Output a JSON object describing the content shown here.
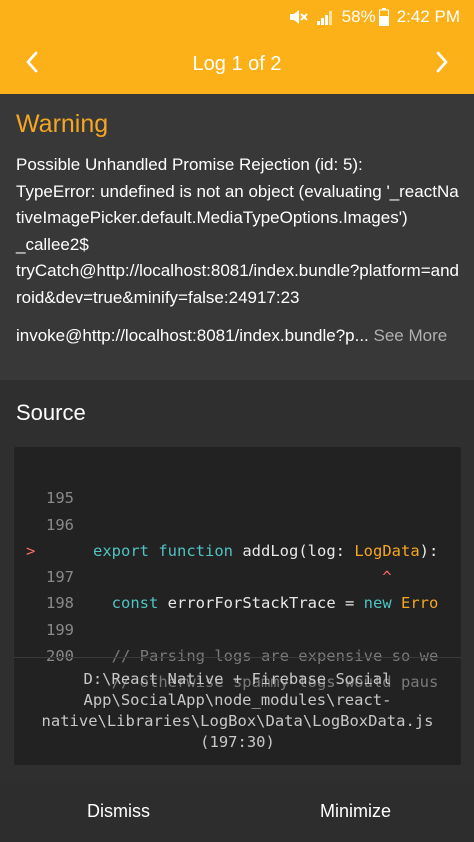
{
  "status_bar": {
    "mute_icon": "mute-icon",
    "signal_icon": "signal-icon",
    "battery_percent": "58%",
    "battery_icon": "battery-icon",
    "time": "2:42 PM"
  },
  "header": {
    "title": "Log 1 of 2",
    "prev_icon": "chevron-left-icon",
    "next_icon": "chevron-right-icon",
    "accent_color": "#fbb117"
  },
  "message": {
    "level": "Warning",
    "level_color": "#f5a623",
    "text": "Possible Unhandled Promise Rejection (id: 5):\nTypeError: undefined is not an object (evaluating '_reactNativeImagePicker.default.MediaTypeOptions.Images')\n_callee2$\ntryCatch@http://localhost:8081/index.bundle?platform=android&dev=true&minify=false:24917:23",
    "truncated_line": "invoke@http://localhost:8081/index.bundle?p...",
    "see_more": "See More"
  },
  "source": {
    "title": "Source",
    "lines": [
      {
        "num": "195",
        "marker": "",
        "code": ""
      },
      {
        "num": "196",
        "marker": "",
        "code": "export function addLog(log: LogData):"
      },
      {
        "num": "197",
        "marker": ">",
        "code": "  const errorForStackTrace = new Erro"
      },
      {
        "num": "",
        "marker": "",
        "code": "                               ^"
      },
      {
        "num": "198",
        "marker": "",
        "code": ""
      },
      {
        "num": "199",
        "marker": "",
        "code": "  // Parsing logs are expensive so we"
      },
      {
        "num": "200",
        "marker": "",
        "code": "  // otherwise spammy logs would paus"
      }
    ],
    "file_path_lines": [
      "D:\\React Native + Firebase Social",
      "App\\SocialApp\\node_modules\\react-",
      "native\\Libraries\\LogBox\\Data\\LogBoxData.js",
      "(197:30)"
    ]
  },
  "footer": {
    "dismiss": "Dismiss",
    "minimize": "Minimize"
  }
}
